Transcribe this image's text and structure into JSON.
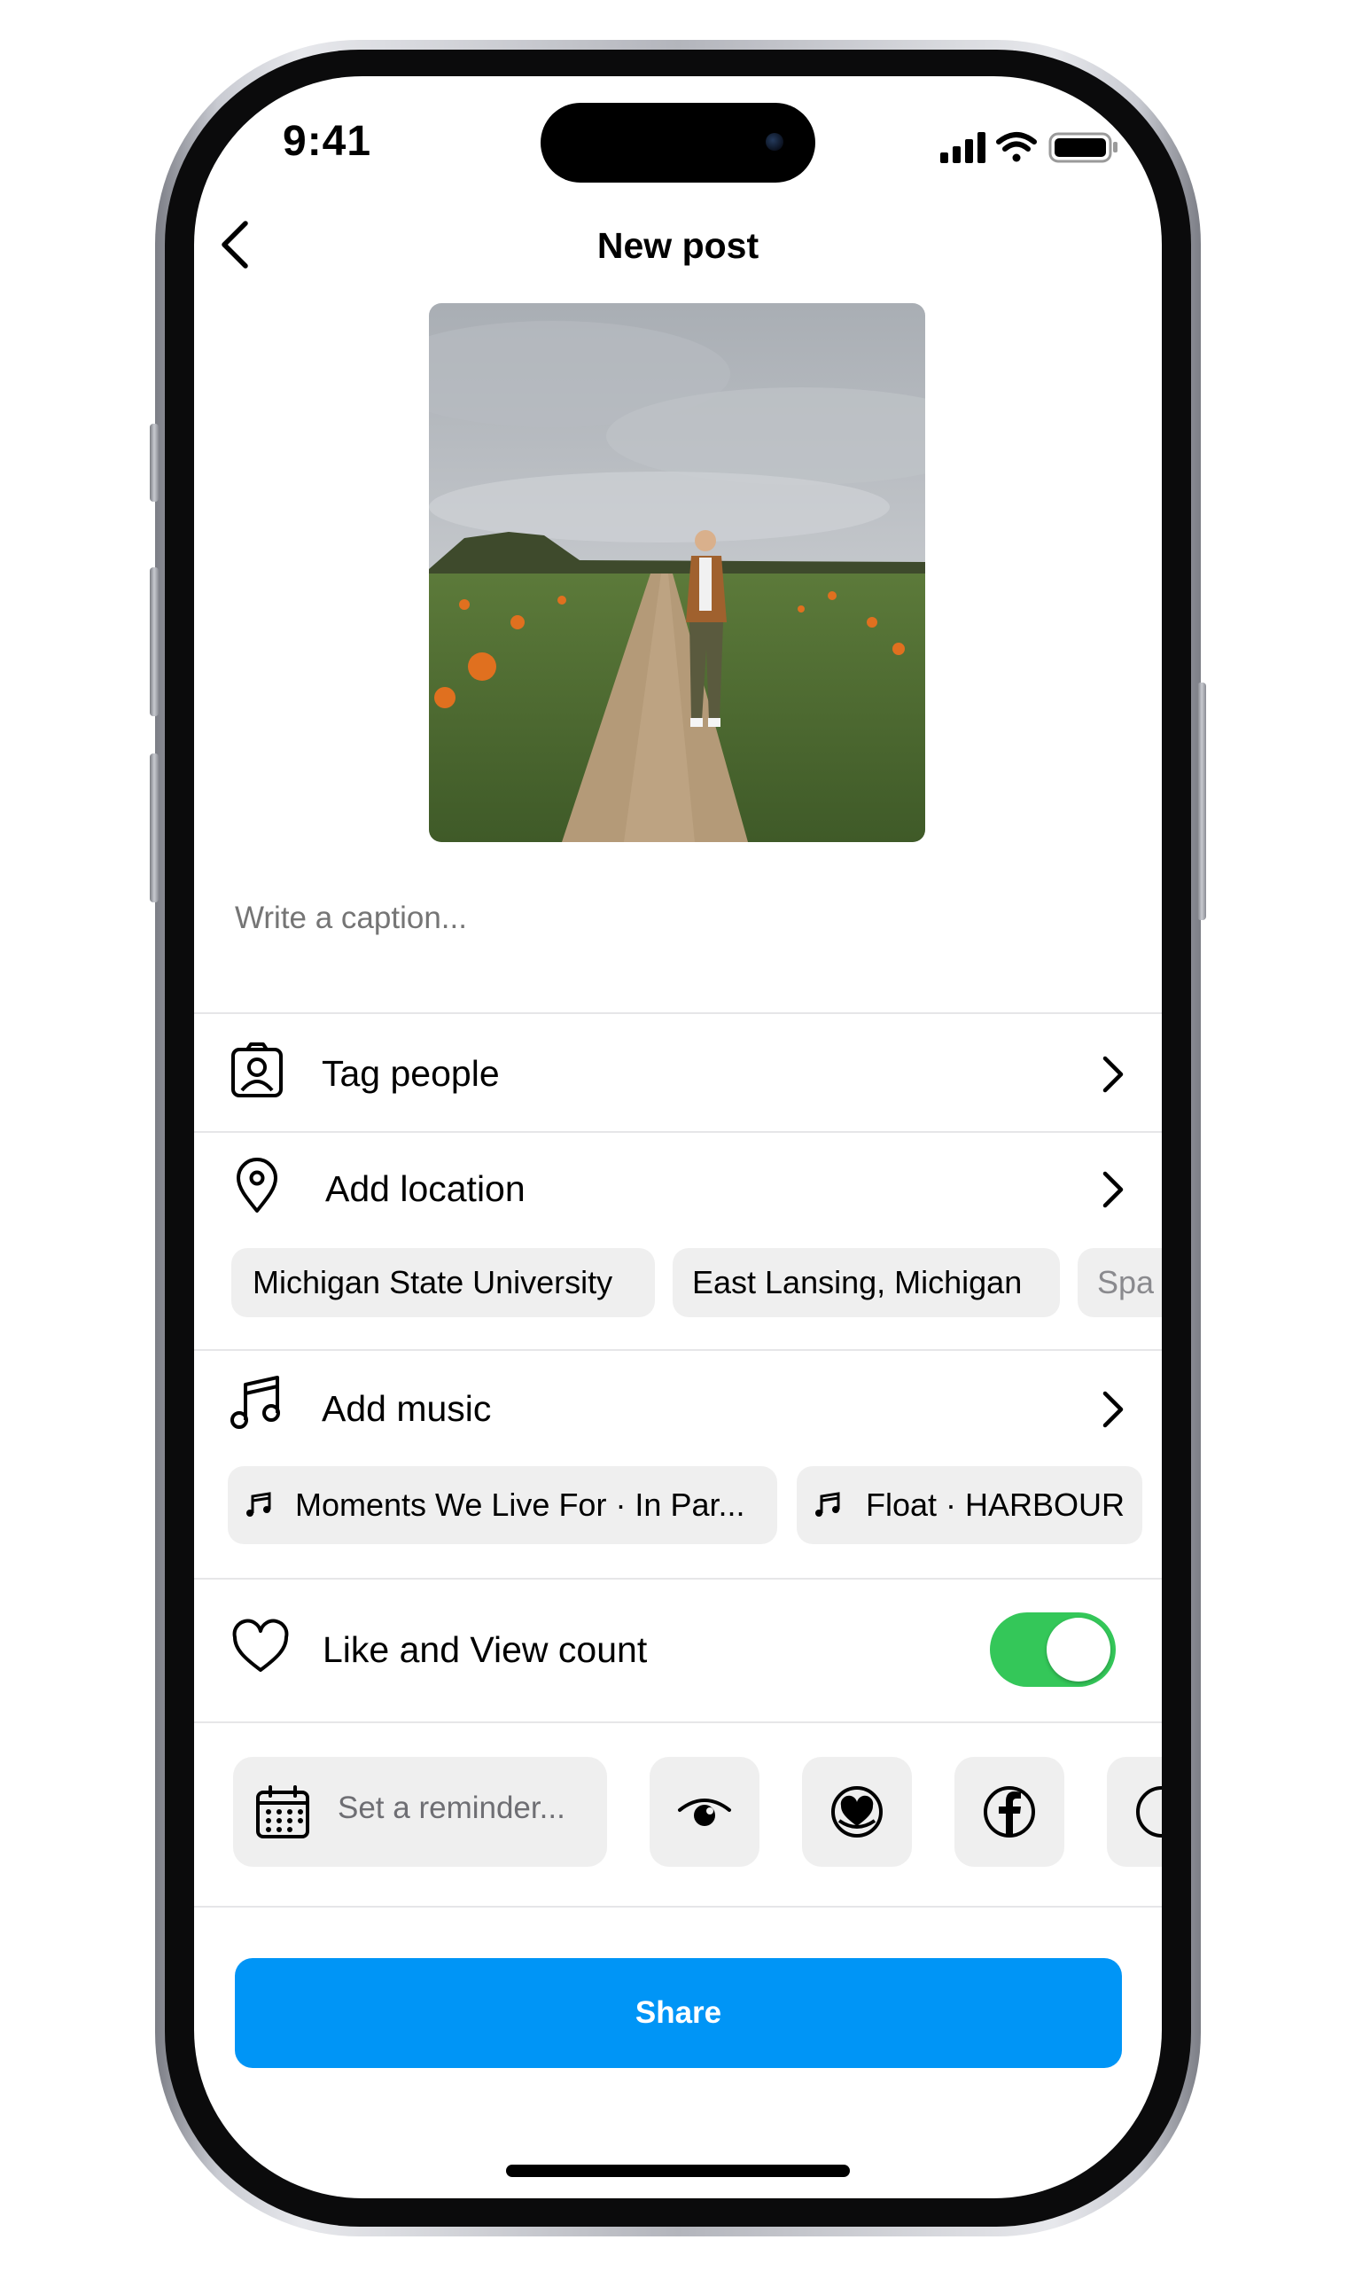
{
  "status_bar": {
    "time": "9:41"
  },
  "header": {
    "title": "New post"
  },
  "caption": {
    "placeholder": "Write a caption..."
  },
  "rows": {
    "tag_people": {
      "label": "Tag people"
    },
    "add_location": {
      "label": "Add location",
      "suggestions": [
        "Michigan State University",
        "East Lansing, Michigan",
        "Spa"
      ]
    },
    "add_music": {
      "label": "Add music",
      "suggestions": [
        "Moments We Live For · In Par...",
        "Float · HARBOUR"
      ]
    },
    "like_view_count": {
      "label": "Like and View count",
      "enabled": true
    }
  },
  "actions": {
    "reminder_placeholder": "Set a reminder...",
    "icons": [
      "calendar-icon",
      "eye-icon",
      "heart-badge-icon",
      "facebook-icon"
    ]
  },
  "share": {
    "label": "Share"
  },
  "colors": {
    "accent": "#0095f6",
    "toggle_on": "#34c759",
    "chip_bg": "#efefef",
    "placeholder_text": "#8a8a8e"
  }
}
